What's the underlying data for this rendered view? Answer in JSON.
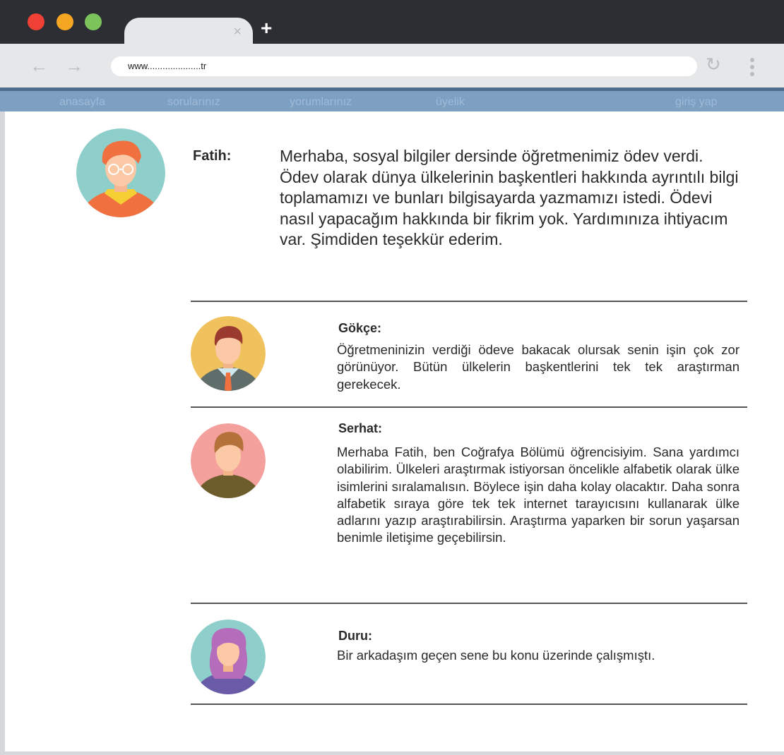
{
  "browser": {
    "window_controls": [
      "close-dot",
      "minimize-dot",
      "maximize-dot"
    ],
    "tab": {
      "close_glyph": "×"
    },
    "new_tab_glyph": "+",
    "back_glyph": "←",
    "forward_glyph": "→",
    "reload_glyph": "↻",
    "url": "www.....................tr"
  },
  "nav": {
    "home": "anasayfa",
    "questions": "sorularınız",
    "comments": "yorumlarınız",
    "membership": "üyelik",
    "login": "giriş yap"
  },
  "question": {
    "author": "Fatih:",
    "text": "Merhaba, sosyal bilgiler dersinde öğretmenimiz ödev verdi. Ödev olarak dünya ülkelerinin başkentleri hakkında ayrıntılı bilgi toplamamızı ve bunları bilgisayarda yazmamızı istedi. Ödevi nasıl yapacağım hakkında bir fikrim yok. Yardımınıza ihtiyacım var. Şimdiden teşekkür ederim."
  },
  "replies": [
    {
      "author": "Gökçe:",
      "text": "Öğretmeninizin verdiği ödeve bakacak olursak senin işin çok zor görünüyor. Bütün ülkelerin başkentlerini tek tek araştırman gerekecek."
    },
    {
      "author": "Serhat:",
      "text": "Merhaba Fatih, ben Coğrafya Bölümü öğrencisiyim. Sana yardımcı olabilirim. Ülkeleri araştırmak istiyorsan öncelikle alfabetik olarak ülke isimlerini sıralamalısın. Böylece işin daha kolay olacaktır. Daha sonra alfabetik sıraya göre tek tek internet tarayıcısını kullanarak ülke adlarını yazıp araştırabilirsin. Araştırma yaparken bir sorun yaşarsan benimle iletişime geçebilirsin."
    },
    {
      "author": "Duru:",
      "text": "Bir arkadaşım geçen sene bu konu üzerinde çalışmıştı."
    }
  ],
  "colors": {
    "titlebar": "#2d2e33",
    "toolbar": "#e6e7e8",
    "navbar": "#7d9fc2",
    "navbar_text": "#9fbad6",
    "close": "#ee4035",
    "minimize": "#f5a623",
    "maximize": "#7dc35c"
  }
}
